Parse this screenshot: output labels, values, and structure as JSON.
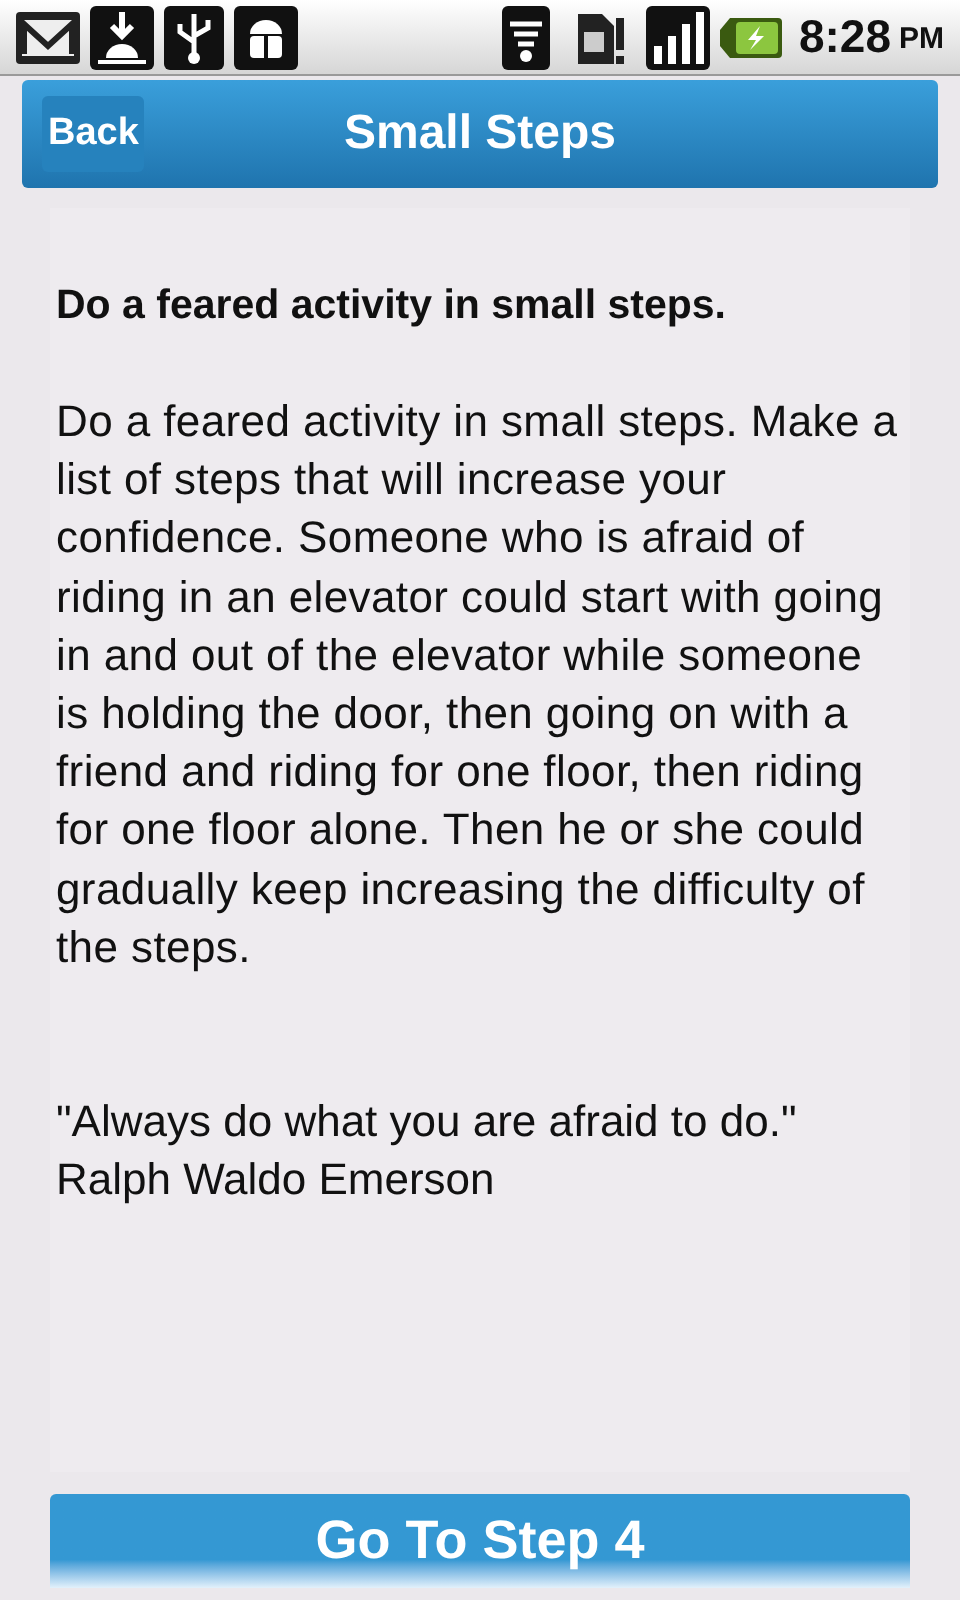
{
  "status_bar": {
    "time": "8:28",
    "period": "PM"
  },
  "header": {
    "back_button": "Back",
    "title": "Small Steps"
  },
  "content": {
    "heading": "Do a feared activity in small steps.",
    "body": "Do a feared activity in small steps. Make a list of steps that will increase your confidence. Someone who is afraid of riding in an elevator could start with going in and out of the elevator while someone is holding the door, then going on with a friend and riding for one floor, then riding for one floor alone. Then he or she could gradually keep increasing the difficulty of the steps.",
    "quote": "\"Always do what you are afraid to do.\"",
    "author": "Ralph Waldo Emerson"
  },
  "next_button": "Go To Step 4"
}
